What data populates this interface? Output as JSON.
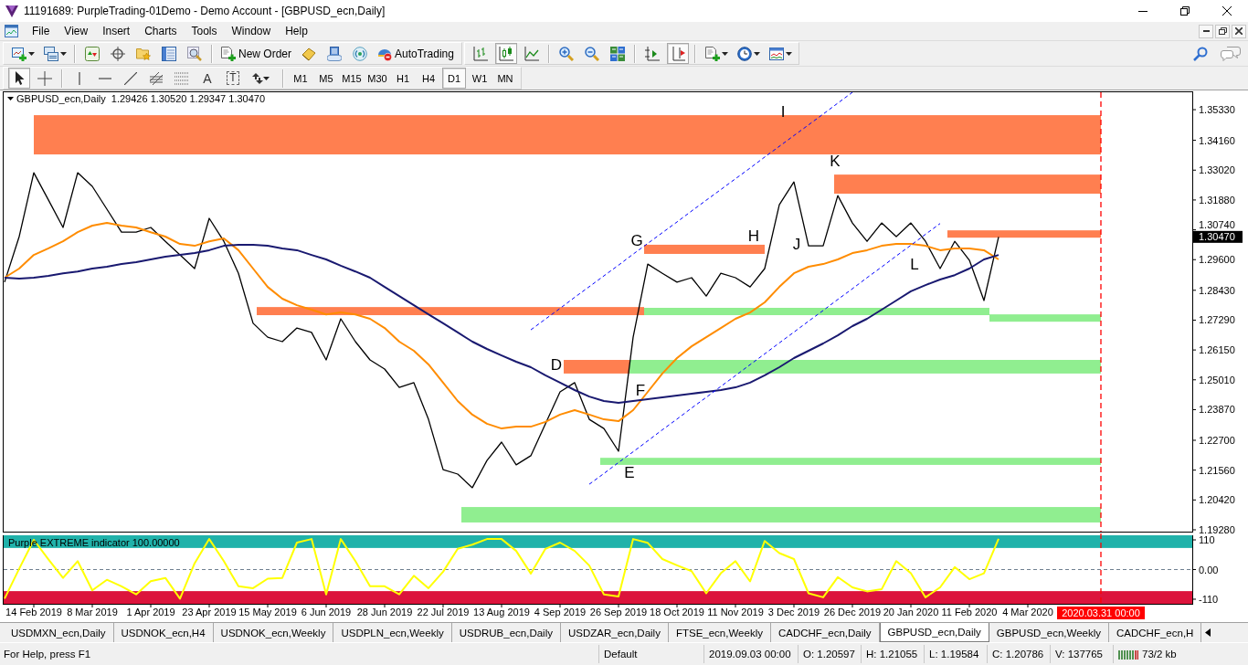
{
  "window": {
    "title": "11191689: PurpleTrading-01Demo - Demo Account - [GBPUSD_ecn,Daily]"
  },
  "menu": [
    "File",
    "View",
    "Insert",
    "Charts",
    "Tools",
    "Window",
    "Help"
  ],
  "toolbar": {
    "new_order": "New Order",
    "auto_trading": "AutoTrading",
    "chart_types": [
      {
        "kind": "bars",
        "on": false
      },
      {
        "kind": "candles",
        "on": true
      },
      {
        "kind": "line",
        "on": false
      }
    ],
    "view_toggles": [
      {
        "kind": "shift",
        "on": false
      },
      {
        "kind": "autoscroll",
        "on": true
      }
    ]
  },
  "drawing_toolbar": {
    "tools": [
      {
        "kind": "cursor",
        "on": true
      },
      {
        "kind": "crosshair",
        "on": false
      },
      {
        "kind": "vline",
        "on": false
      },
      {
        "kind": "hline",
        "on": false
      },
      {
        "kind": "trendline",
        "on": false
      },
      {
        "kind": "channel",
        "on": false
      },
      {
        "kind": "fibo",
        "on": false
      },
      {
        "kind": "text",
        "glyph": "A",
        "on": false
      },
      {
        "kind": "label",
        "glyph": "T",
        "on": false
      },
      {
        "kind": "arrows",
        "on": false
      }
    ],
    "timeframes": [
      {
        "label": "M1",
        "selected": false
      },
      {
        "label": "M5",
        "selected": false
      },
      {
        "label": "M15",
        "selected": false
      },
      {
        "label": "M30",
        "selected": false
      },
      {
        "label": "H1",
        "selected": false
      },
      {
        "label": "H4",
        "selected": false
      },
      {
        "label": "D1",
        "selected": true
      },
      {
        "label": "W1",
        "selected": false
      },
      {
        "label": "MN",
        "selected": false
      }
    ]
  },
  "chart": {
    "symbol": "GBPUSD_ecn,Daily",
    "ohlc": "1.29426 1.30520 1.29347 1.30470",
    "chart_data": {
      "type": "line",
      "categories": [
        null,
        null,
        "14 Feb 2019",
        null,
        null,
        null,
        "8 Mar 2019",
        null,
        null,
        null,
        "1 Apr 2019",
        null,
        null,
        null,
        "23 Apr 2019",
        null,
        null,
        null,
        "15 May 2019",
        null,
        null,
        null,
        "6 Jun 2019",
        null,
        null,
        null,
        "28 Jun 2019",
        null,
        null,
        null,
        "22 Jul 2019",
        null,
        null,
        null,
        "13 Aug 2019",
        null,
        null,
        null,
        "4 Sep 2019",
        null,
        null,
        null,
        "26 Sep 2019",
        null,
        null,
        null,
        "18 Oct 2019",
        null,
        null,
        null,
        "11 Nov 2019",
        null,
        null,
        null,
        "3 Dec 2019",
        null,
        null,
        null,
        "26 Dec 2019",
        null,
        null,
        null,
        "20 Jan 2020",
        null,
        null,
        null,
        "11 Feb 2020",
        null,
        null,
        null,
        "4 Mar 2020",
        null,
        null,
        null,
        null,
        "2020.03.31 00:00",
        null,
        null,
        null,
        null,
        null,
        null
      ],
      "series": [
        {
          "color": "#000000",
          "values": [
            1.2874,
            1.3048,
            1.3292,
            1.3188,
            1.3083,
            1.3292,
            1.324,
            1.3153,
            1.3065,
            1.3065,
            1.3083,
            1.303,
            1.2978,
            1.2926,
            1.3118,
            1.303,
            1.2908,
            1.2717,
            1.2664,
            1.2647,
            1.2699,
            1.2682,
            1.2577,
            1.2734,
            1.2647,
            1.2577,
            1.2542,
            1.2472,
            1.249,
            1.235,
            1.2158,
            1.2141,
            1.2089,
            1.2193,
            1.2263,
            1.2176,
            1.2211,
            1.2333,
            1.2455,
            1.249,
            1.235,
            1.2315,
            1.2228,
            1.2664,
            1.2943,
            1.2908,
            1.2874,
            1.2891,
            1.2821,
            1.2908,
            1.2891,
            1.2856,
            1.2926,
            1.317,
            1.3257,
            1.3013,
            1.3013,
            1.3205,
            1.31,
            1.303,
            1.31,
            1.3048,
            1.31,
            1.303,
            1.2926,
            1.303,
            1.2958,
            1.2804,
            1.3047,
            null,
            null,
            null,
            null,
            null,
            null,
            null,
            null,
            null,
            null,
            null,
            null,
            null
          ]
        },
        {
          "color": "#ff8c00",
          "values": [
            1.2891,
            1.2926,
            1.2978,
            1.3003,
            1.303,
            1.3065,
            1.309,
            1.31,
            1.309,
            1.3083,
            1.3065,
            1.3048,
            1.302,
            1.3013,
            1.303,
            1.3041,
            1.2996,
            1.2926,
            1.2856,
            1.2811,
            1.2786,
            1.2769,
            1.2751,
            1.2758,
            1.2751,
            1.2734,
            1.2699,
            1.2647,
            1.2612,
            1.256,
            1.249,
            1.242,
            1.2368,
            1.2333,
            1.2315,
            1.2322,
            1.2322,
            1.234,
            1.2368,
            1.2385,
            1.2368,
            1.235,
            1.2343,
            1.2385,
            1.2455,
            1.2525,
            1.2584,
            1.2629,
            1.2664,
            1.2699,
            1.2734,
            1.2758,
            1.2797,
            1.2856,
            1.2908,
            1.2933,
            1.2943,
            1.2961,
            1.2985,
            1.2996,
            1.3013,
            1.302,
            1.302,
            1.3013,
            1.2996,
            1.3003,
            1.3003,
            1.2996,
            1.2961,
            null,
            null,
            null,
            null,
            null,
            null,
            null,
            null,
            null,
            null,
            null,
            null,
            null
          ]
        },
        {
          "color": "#191970",
          "values": [
            1.2891,
            1.2888,
            1.2891,
            1.2898,
            1.2908,
            1.2915,
            1.2926,
            1.2933,
            1.2943,
            1.295,
            1.2961,
            1.2971,
            1.2978,
            1.2985,
            1.2996,
            1.3013,
            1.3017,
            1.3017,
            1.3013,
            1.3003,
            1.2996,
            1.2978,
            1.2961,
            1.2937,
            1.2915,
            1.2891,
            1.2856,
            1.2821,
            1.2786,
            1.2751,
            1.2717,
            1.2682,
            1.2647,
            1.2619,
            1.2594,
            1.257,
            1.2549,
            1.2518,
            1.249,
            1.2462,
            1.2437,
            1.242,
            1.2413,
            1.242,
            1.2427,
            1.2434,
            1.2441,
            1.2448,
            1.2455,
            1.2462,
            1.2472,
            1.249,
            1.2518,
            1.2549,
            1.2584,
            1.2612,
            1.264,
            1.2671,
            1.2706,
            1.2734,
            1.2769,
            1.2804,
            1.2839,
            1.2863,
            1.2884,
            1.2901,
            1.2926,
            1.2961,
            1.2978,
            null,
            null,
            null,
            null,
            null,
            null,
            null,
            null,
            null,
            null,
            null,
            null,
            null
          ]
        },
        {
          "color": "#0000ff",
          "line_style": "dashed",
          "values": [
            null,
            null,
            null,
            null,
            null,
            null,
            null,
            null,
            null,
            null,
            null,
            null,
            null,
            null,
            null,
            null,
            null,
            null,
            null,
            null,
            null,
            null,
            null,
            null,
            null,
            null,
            null,
            null,
            null,
            null,
            null,
            null,
            null,
            null,
            null,
            null,
            1.2692,
            1.2733,
            1.2774,
            1.2816,
            1.2857,
            1.2898,
            1.2939,
            1.2981,
            1.3022,
            1.3063,
            1.3104,
            1.3146,
            1.3187,
            1.3228,
            1.3269,
            1.331,
            1.3352,
            1.3393,
            1.3434,
            1.3475,
            1.3516,
            1.3558,
            1.3599,
            null,
            null,
            null,
            null,
            null,
            null,
            null,
            null,
            null,
            null,
            null,
            null,
            null,
            null,
            null,
            null,
            null,
            null,
            null,
            null,
            null,
            null,
            null
          ]
        },
        {
          "color": "#0000ff",
          "line_style": "dashed",
          "values": [
            null,
            null,
            null,
            null,
            null,
            null,
            null,
            null,
            null,
            null,
            null,
            null,
            null,
            null,
            null,
            null,
            null,
            null,
            null,
            null,
            null,
            null,
            null,
            null,
            null,
            null,
            null,
            null,
            null,
            null,
            null,
            null,
            null,
            null,
            null,
            null,
            null,
            null,
            null,
            null,
            1.2102,
            1.2143,
            1.2185,
            1.2226,
            1.2268,
            1.231,
            1.2351,
            1.2393,
            1.2434,
            1.2476,
            1.2517,
            1.2559,
            1.26,
            1.2642,
            1.2683,
            1.2725,
            1.2766,
            1.2808,
            1.2849,
            1.2891,
            1.2932,
            1.2974,
            1.3015,
            1.3057,
            1.3098,
            null,
            null,
            null,
            null,
            null,
            null,
            null,
            null,
            null,
            null,
            null,
            null,
            null,
            null,
            null,
            null,
            null
          ]
        }
      ],
      "ylim": [
        1.1921,
        1.3603
      ],
      "yticks": [
        {
          "value": 1.3533,
          "label": "1.35330"
        },
        {
          "value": 1.3416,
          "label": "1.34160"
        },
        {
          "value": 1.3302,
          "label": "1.33020"
        },
        {
          "value": 1.3188,
          "label": "1.31880"
        },
        {
          "value": 1.3074,
          "label": "1.30740"
        },
        {
          "value": 1.296,
          "label": "1.29600"
        },
        {
          "value": 1.2843,
          "label": "1.28430"
        },
        {
          "value": 1.2729,
          "label": "1.27290"
        },
        {
          "value": 1.2615,
          "label": "1.26150"
        },
        {
          "value": 1.2501,
          "label": "1.25010"
        },
        {
          "value": 1.2387,
          "label": "1.23870"
        },
        {
          "value": 1.227,
          "label": "1.22700"
        },
        {
          "value": 1.2156,
          "label": "1.21560"
        },
        {
          "value": 1.2042,
          "label": "1.20420"
        },
        {
          "value": 1.1928,
          "label": "1.19280"
        }
      ],
      "bands": [
        {
          "axis": "y",
          "from": 1.3362,
          "to": 1.3512,
          "color": "#ff7f50"
        },
        {
          "axis": "y",
          "from": 1.3212,
          "to": 1.3285,
          "color": "#ff7f50"
        },
        {
          "axis": "y",
          "from": 1.3044,
          "to": 1.3072,
          "color": "#ff7f50"
        },
        {
          "axis": "y",
          "from": 1.2982,
          "to": 1.3017,
          "color": "#ff7f50"
        },
        {
          "axis": "y",
          "from": 1.2748,
          "to": 1.2779,
          "color": "#ff7f50"
        },
        {
          "axis": "y",
          "from": 1.2525,
          "to": 1.2577,
          "color": "#ff7f50"
        },
        {
          "axis": "y",
          "from": 1.2748,
          "to": 1.2776,
          "color": "#90ee90"
        },
        {
          "axis": "y",
          "from": 1.2723,
          "to": 1.2751,
          "color": "#90ee90"
        },
        {
          "axis": "y",
          "from": 1.2525,
          "to": 1.2577,
          "color": "#90ee90"
        },
        {
          "axis": "y",
          "from": 1.2176,
          "to": 1.2203,
          "color": "#90ee90"
        },
        {
          "axis": "y",
          "from": 1.1956,
          "to": 1.2015,
          "color": "#90ee90"
        }
      ],
      "annotations": [
        "D",
        "E",
        "F",
        "G",
        "H",
        "I",
        "J",
        "K",
        "L",
        "1.30470"
      ]
    }
  },
  "indicator": {
    "chart_data": {
      "type": "line",
      "title": "Purple EXTREME indicator 100.00000",
      "categories": [
        null,
        null,
        null,
        null,
        null,
        null,
        null,
        null,
        null,
        null,
        null,
        null,
        null,
        null,
        null,
        null,
        null,
        null,
        null,
        null,
        null,
        null,
        null,
        null,
        null,
        null,
        null,
        null,
        null,
        null,
        null,
        null,
        null,
        null,
        null,
        null,
        null,
        null,
        null,
        null,
        null,
        null,
        null,
        null,
        null,
        null,
        null,
        null,
        null,
        null,
        null,
        null,
        null,
        null,
        null,
        null,
        null,
        null,
        null,
        null,
        null,
        null,
        null,
        null,
        null,
        null,
        null,
        null,
        null,
        null,
        null,
        null,
        null,
        null,
        null,
        null,
        null,
        null,
        null,
        null,
        null,
        null
      ],
      "series": [
        {
          "color": "#ffff00",
          "values": [
            -108,
            3,
            110,
            38,
            -31,
            31,
            -77,
            -38,
            -62,
            -92,
            -43,
            -31,
            -108,
            23,
            113,
            31,
            -62,
            -69,
            -34,
            -31,
            100,
            113,
            -92,
            113,
            31,
            -62,
            -62,
            -92,
            -23,
            -69,
            -8,
            77,
            92,
            113,
            113,
            69,
            -15,
            77,
            100,
            69,
            15,
            -92,
            -100,
            113,
            99,
            39,
            16,
            -6,
            -88,
            -14,
            31,
            -44,
            106,
            61,
            39,
            -88,
            -103,
            -28,
            -66,
            -81,
            -73,
            31,
            -14,
            -103,
            -66,
            9,
            -36,
            -14,
            114,
            null,
            null,
            null,
            null,
            null,
            null,
            null,
            null,
            null,
            null,
            null,
            null,
            null
          ]
        }
      ],
      "ylim": [
        -127,
        127
      ],
      "yticks": [
        110,
        {
          "value": 0,
          "label": "0.00"
        },
        -110
      ],
      "bands": [
        {
          "axis": "y",
          "from": 80,
          "to": 127,
          "color": "#20b2aa"
        },
        {
          "axis": "y",
          "from": -127,
          "to": -80,
          "color": "#dc143c"
        }
      ],
      "ref_lines": [
        {
          "axis": "y",
          "value": 0
        }
      ]
    }
  },
  "tabs": [
    {
      "label": "USDMXN_ecn,Daily",
      "selected": false
    },
    {
      "label": "USDNOK_ecn,H4",
      "selected": false
    },
    {
      "label": "USDNOK_ecn,Weekly",
      "selected": false
    },
    {
      "label": "USDPLN_ecn,Weekly",
      "selected": false
    },
    {
      "label": "USDRUB_ecn,Daily",
      "selected": false
    },
    {
      "label": "USDZAR_ecn,Daily",
      "selected": false
    },
    {
      "label": "FTSE_ecn,Weekly",
      "selected": false
    },
    {
      "label": "CADCHF_ecn,Daily",
      "selected": false
    },
    {
      "label": "GBPUSD_ecn,Daily",
      "selected": true
    },
    {
      "label": "GBPUSD_ecn,Weekly",
      "selected": false
    },
    {
      "label": "CADCHF_ecn,H",
      "selected": false
    }
  ],
  "status_bar": {
    "help": "For Help, press F1",
    "profile": "Default",
    "time": "2019.09.03 00:00",
    "open": "O: 1.20597",
    "high": "H: 1.21055",
    "low": "L: 1.19584",
    "close": "C: 1.20786",
    "volume": "V: 137765",
    "traffic": "73/2 kb"
  }
}
